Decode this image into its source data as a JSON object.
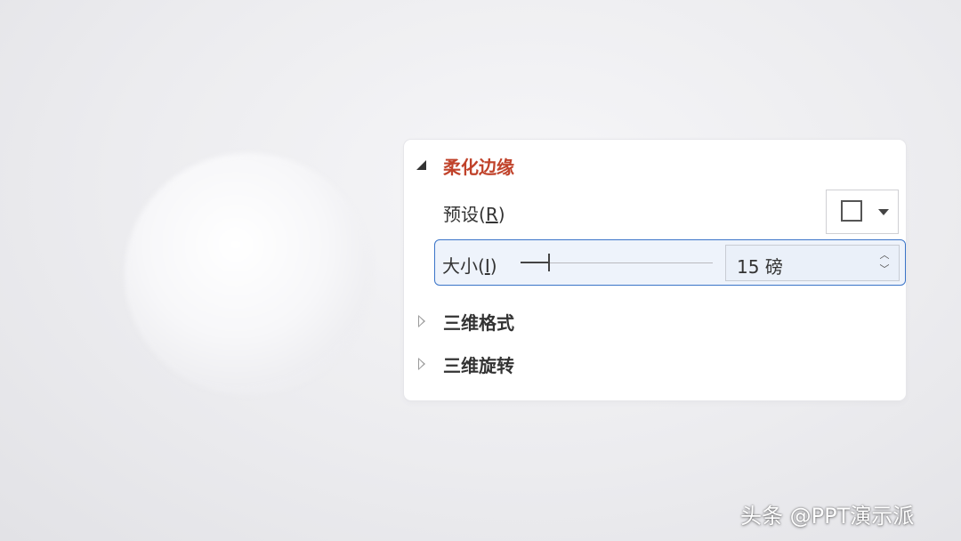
{
  "soft_edges": {
    "title": "柔化边缘",
    "preset_label": "预设",
    "preset_key": "R",
    "size_label": "大小",
    "size_key": "I",
    "size_value": "15",
    "size_unit": "磅",
    "slider_fraction": 0.15
  },
  "sections": {
    "format_3d": "三维格式",
    "rotation_3d": "三维旋转"
  },
  "icons": {
    "expanded": "triangle-expanded-icon",
    "collapsed": "triangle-collapsed-icon",
    "preset": "square-outline-icon",
    "dropdown": "chevron-down-icon",
    "spin_up": "chevron-up-icon",
    "spin_down": "chevron-down-icon"
  },
  "colors": {
    "active_heading": "#c0422a",
    "focus_border": "#3a74c8"
  },
  "watermark": "头条 @PPT演示派"
}
